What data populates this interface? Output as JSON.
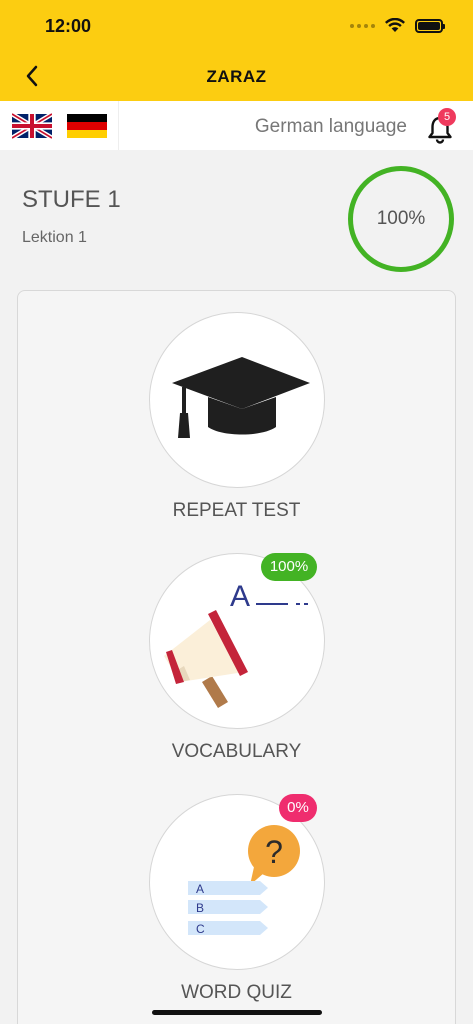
{
  "status_bar": {
    "time": "12:00"
  },
  "nav": {
    "title": "ZARAZ"
  },
  "language_bar": {
    "label": "German language",
    "notification_count": "5"
  },
  "lesson": {
    "level": "STUFE 1",
    "lesson": "Lektion 1",
    "progress_label": "100%",
    "progress_value": 1.0
  },
  "activities": [
    {
      "label": "REPEAT TEST",
      "icon": "graduation-cap-icon"
    },
    {
      "label": "VOCABULARY",
      "icon": "megaphone-icon",
      "badge": "100%",
      "badge_color": "#43b324",
      "word_letter": "A"
    },
    {
      "label": "WORD QUIZ",
      "icon": "quiz-icon",
      "badge": "0%",
      "badge_color": "#ef2d6e",
      "question_mark": "?",
      "options": [
        "A",
        "B",
        "C"
      ]
    }
  ],
  "colors": {
    "header": "#fccd11",
    "ring": "#43b324",
    "badge_red": "#ef3a5d"
  }
}
